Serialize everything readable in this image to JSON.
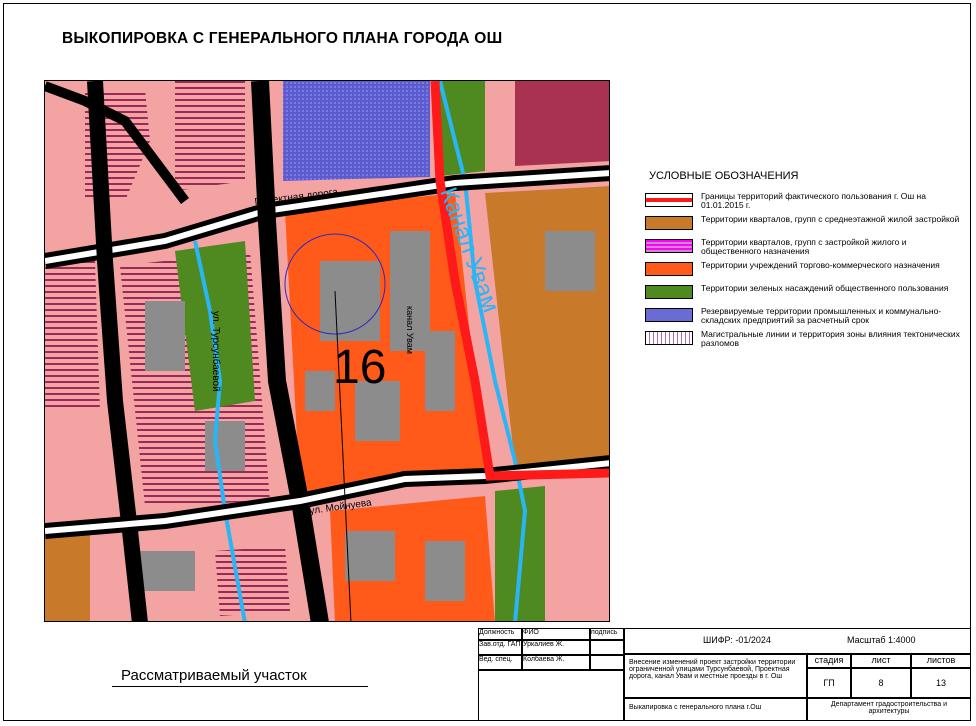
{
  "title": "ВЫКОПИРОВКА С ГЕНЕРАЛЬНОГО ПЛАНА ГОРОДА ОШ",
  "map": {
    "labels": {
      "project_road": "Проектная дорога",
      "tursunbaeva": "ул. Турсунбаевой",
      "moinueva": "ул. Мойнуева",
      "canal_small": "канал Увам",
      "canal_big": "Канал Увам",
      "zone_number": "16"
    },
    "colors": {
      "commercial": "#ff5a1a",
      "residential": "#f4a3a3",
      "mixed": "#c0392b",
      "green": "#4e8a1f",
      "industrial": "#6b6bd6",
      "midrise": "#c87a2a",
      "road": "#000000",
      "canal": "#29b6f6",
      "border": "#ff1a1a",
      "building": "#8c8c8c"
    }
  },
  "legend": {
    "title": "УСЛОВНЫЕ ОБОЗНАЧЕНИЯ",
    "items": [
      {
        "text": "Границы территорий фактического пользования г. Ош на 01.01.2015 г.",
        "swatch": "border"
      },
      {
        "text": "Территории кварталов, групп с среднеэтажной жилой застройкой",
        "swatch": "midrise"
      },
      {
        "text": "Территории кварталов, групп с застройкой жилого и общественного назначения",
        "swatch": "mixed"
      },
      {
        "text": "Территории учреждений торгово-коммерческого назначения",
        "swatch": "commercial"
      },
      {
        "text": "Территории зеленых насаждений общественного пользования",
        "swatch": "green"
      },
      {
        "text": "Резервируемые территории промышленных и коммунально-складских предприятий за расчетный срок",
        "swatch": "industrial"
      },
      {
        "text": "Магистральные линии и территория зоны влияния тектонических разломов",
        "swatch": "tectonic"
      }
    ]
  },
  "callout": "Рассматриваемый участок",
  "stamp": {
    "h_position": "Должность",
    "h_name": "ФИО",
    "h_sign": "подпись",
    "row1_pos": "Зав.отд. ГАП",
    "row1_name": "Уркалиев Ж.",
    "row2_pos": "Вед. спец.",
    "row2_name": "Колбаева Ж.",
    "code": "ШИФР: -01/2024",
    "scale": "Масштаб 1:4000",
    "description": "Внесение изменений проект застройки территории ограниченной улицами Турсунбаевой, Проектная дорога, канал Увам и местные проезды в г. Ош",
    "stage_h": "стадия",
    "sheet_h": "лист",
    "sheets_h": "листов",
    "stage": "ГП",
    "sheet": "8",
    "sheets": "13",
    "drawing_name": "Выкапировка с генерального плана г.Ош",
    "department": "Департамент градостроительства и архитектуры"
  }
}
